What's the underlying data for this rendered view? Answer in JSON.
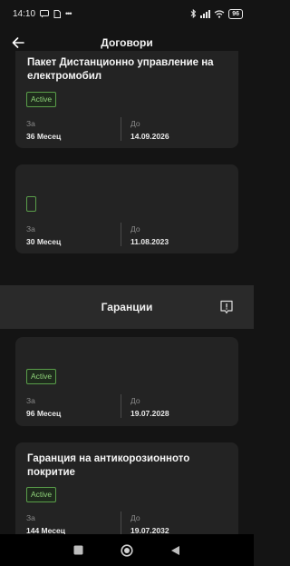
{
  "status": {
    "time": "14:10",
    "battery": "96"
  },
  "header": {
    "title": "Договори"
  },
  "contracts": [
    {
      "title": "Пакет Дистанционно управление на електромобил",
      "status": "Active",
      "for_label": "За",
      "for_value": "36 Месец",
      "to_label": "До",
      "to_value": "14.09.2026"
    },
    {
      "title": "",
      "status": "",
      "for_label": "За",
      "for_value": "30 Месец",
      "to_label": "До",
      "to_value": "11.08.2023"
    }
  ],
  "warranties_section": {
    "title": "Гаранции"
  },
  "warranties": [
    {
      "title": "",
      "status": "Active",
      "for_label": "За",
      "for_value": "96 Месец",
      "to_label": "До",
      "to_value": "19.07.2028"
    },
    {
      "title": "Гаранция на антикорозионното покритие",
      "status": "Active",
      "for_label": "За",
      "for_value": "144 Месец",
      "to_label": "До",
      "to_value": "19.07.2032"
    }
  ],
  "colors": {
    "background": "#141414",
    "card": "#232323",
    "section_bar": "#2a2a2a",
    "active_border": "#5a9e4a",
    "active_text": "#8fd27a"
  },
  "icons": [
    "back-arrow-icon",
    "info-icon",
    "square-icon",
    "circle-home-icon",
    "triangle-back-icon",
    "bluetooth-icon",
    "wifi-icon",
    "signal-icon"
  ]
}
